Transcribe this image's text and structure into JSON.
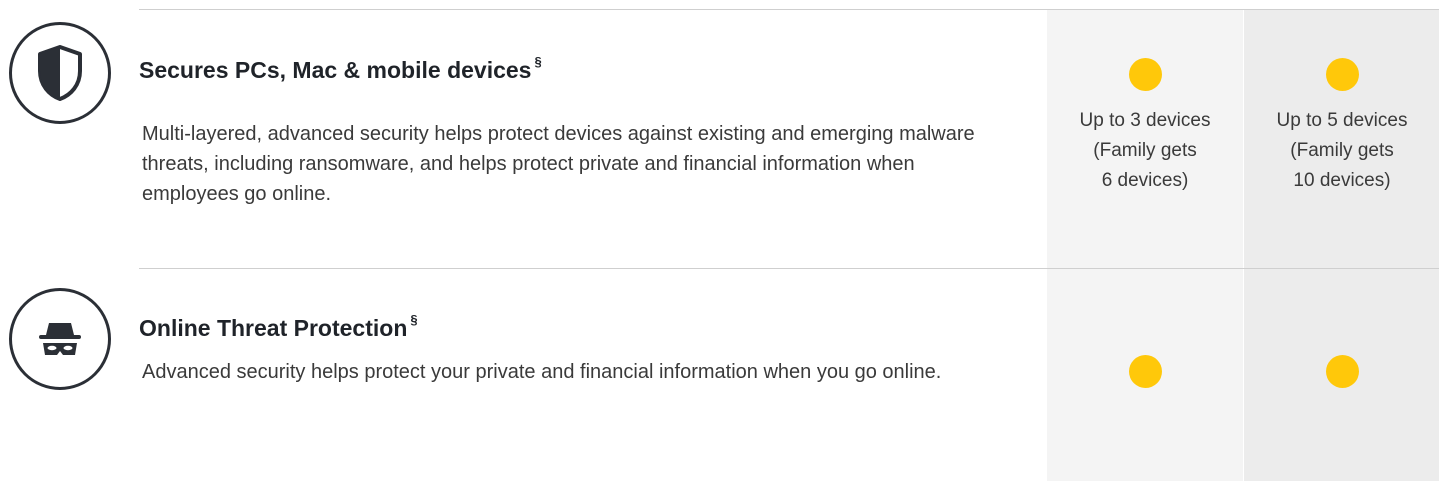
{
  "colors": {
    "accent": "#ffc80a",
    "column_1_bg": "#f4f4f4",
    "column_2_bg": "#ececec",
    "divider": "#cfcfcf",
    "icon_stroke": "#2b2f36"
  },
  "features": [
    {
      "icon": "shield-icon",
      "title": "Secures PCs, Mac & mobile devices",
      "title_mark": "§",
      "description": "Multi-layered, advanced security helps protect devices against existing and emerging malware threats, including ransomware, and helps protect private and financial information when employees go online.",
      "plans": [
        {
          "included": true,
          "lines": [
            "Up to 3 devices",
            "(Family gets",
            "6 devices)"
          ]
        },
        {
          "included": true,
          "lines": [
            "Up to 5 devices",
            "(Family gets",
            "10 devices)"
          ]
        }
      ]
    },
    {
      "icon": "spy-icon",
      "title": "Online Threat Protection",
      "title_mark": "§",
      "description": "Advanced security helps protect your private and financial information when you go online.",
      "plans": [
        {
          "included": true,
          "lines": []
        },
        {
          "included": true,
          "lines": []
        }
      ]
    }
  ]
}
